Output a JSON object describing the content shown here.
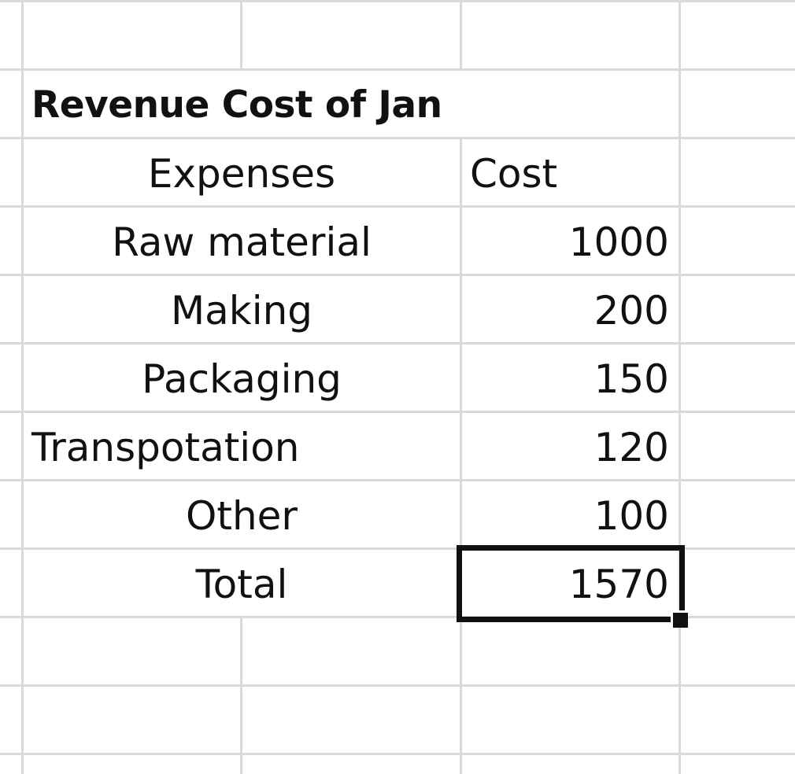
{
  "sheet": {
    "title": "Revenue Cost of Jan",
    "headers": {
      "expenses": "Expenses",
      "cost": "Cost"
    },
    "rows": [
      {
        "label": "Raw material",
        "value": "1000"
      },
      {
        "label": "Making",
        "value": "200"
      },
      {
        "label": "Packaging",
        "value": "150"
      },
      {
        "label": "Transpotation",
        "value": "120"
      },
      {
        "label": "Other",
        "value": "100"
      }
    ],
    "total": {
      "label": "Total",
      "value": "1570"
    },
    "colors": {
      "gridline": "#d9d9d9",
      "text": "#111111",
      "selection_border": "#111111"
    }
  }
}
